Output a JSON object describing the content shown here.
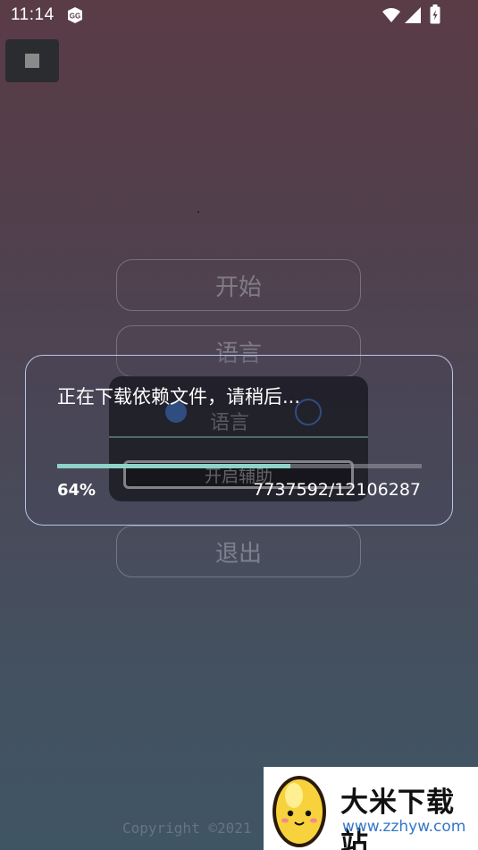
{
  "status_bar": {
    "time": "11:14",
    "icons": [
      "gg-icon",
      "wifi-icon",
      "signal-icon",
      "battery-icon"
    ]
  },
  "floating_button": {
    "icon": "stop-icon"
  },
  "menu": {
    "start_label": "开始",
    "language_label": "语言",
    "exit_label": "退出"
  },
  "background_panel": {
    "option_text": "语言",
    "button_label": "开启辅助"
  },
  "dialog": {
    "title": "正在下载依赖文件，请稍后...",
    "progress_percent": 64,
    "progress_percent_text": "64%",
    "progress_count": "7737592/12106287"
  },
  "footer": {
    "copyright": "Copyright ©2021"
  },
  "watermark": {
    "title": "大米下载站",
    "url": "www.zzhyw.com"
  },
  "colors": {
    "progress_fill": "#8ed3c8",
    "dialog_border": "#b9c5e8",
    "watermark_url": "#3478c6"
  }
}
